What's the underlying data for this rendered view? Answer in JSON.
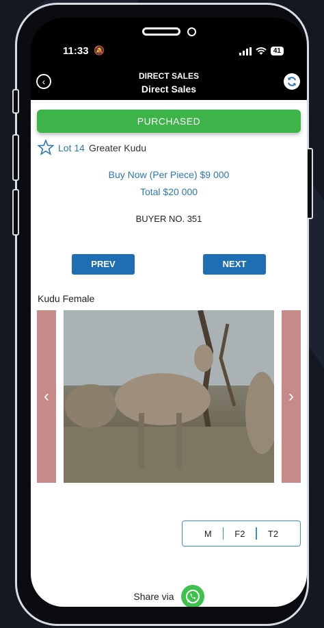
{
  "status_bar": {
    "time": "11:33",
    "battery": "41"
  },
  "header": {
    "title_top": "DIRECT SALES",
    "title_bottom": "Direct Sales"
  },
  "sale": {
    "status": "PURCHASED",
    "lot_label": "Lot 14",
    "lot_name": "Greater Kudu",
    "buy_now_label": "Buy Now (Per Piece)",
    "buy_now_value": "$9 000",
    "total_label": "Total",
    "total_value": "$20 000",
    "buyer": "BUYER NO. 351"
  },
  "nav": {
    "prev_label": "PREV",
    "next_label": "NEXT"
  },
  "animal": {
    "title": "Kudu Female"
  },
  "tags": [
    "M",
    "F2",
    "T2"
  ],
  "share": {
    "label": "Share via"
  },
  "colors": {
    "purchased": "#3db34a",
    "accent": "#2a78b5",
    "button": "#1f6eb3",
    "gallery_arrow": "#c78a88"
  }
}
